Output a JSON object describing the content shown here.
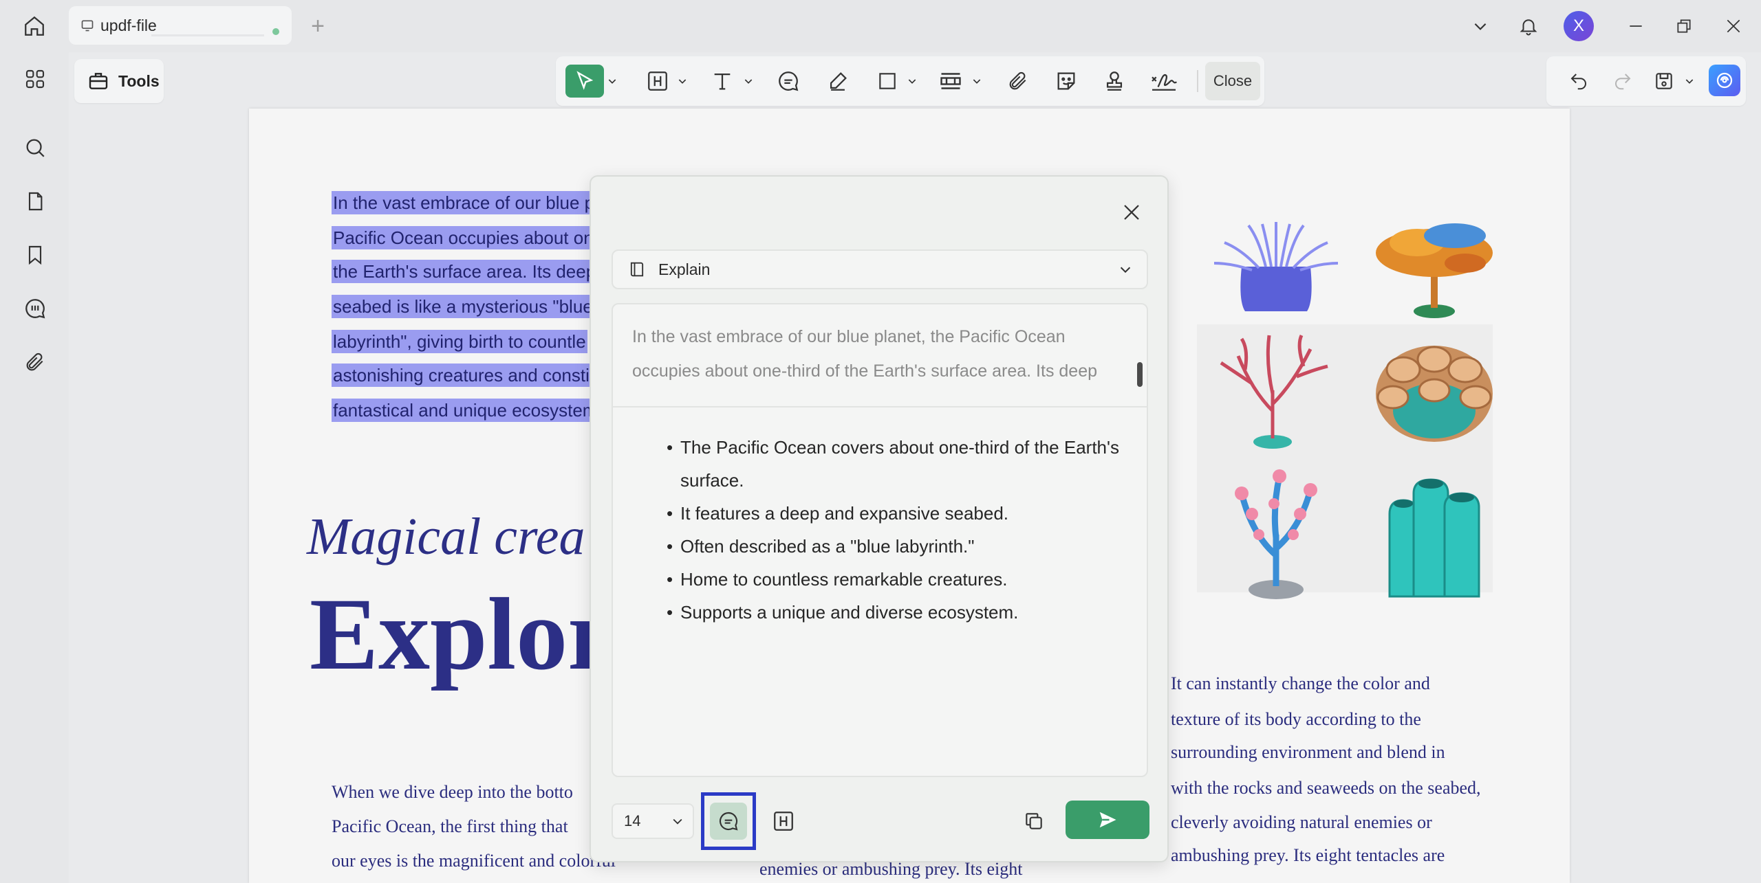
{
  "tab": {
    "title": "updf-file"
  },
  "avatar": {
    "letter": "X"
  },
  "toolbar": {
    "tools_label": "Tools",
    "close_label": "Close"
  },
  "document": {
    "selected_lines": [
      "In the vast embrace of our blue pl",
      "Pacific Ocean occupies about one",
      "the Earth's surface area. Its deep a",
      "seabed is like a mysterious \"blue",
      "labyrinth\", giving birth to countle",
      "astonishing creatures and constitu",
      "fantastical and unique ecosystem."
    ],
    "heading_italic": "Magical crea",
    "heading_big": "Explor",
    "left_para": [
      "When we dive deep into the botto",
      "Pacific Ocean, the first thing that",
      "our eyes is the magnificent and colorful"
    ],
    "middle_line": "enemies or ambushing prey. Its eight",
    "right_para": [
      "It can instantly change the color and",
      "texture of its body according to the",
      "surrounding environment and blend in",
      "with the rocks and seaweeds on the seabed,",
      "cleverly avoiding natural enemies or",
      "ambushing prey. Its eight tentacles are"
    ]
  },
  "dialog": {
    "mode_label": "Explain",
    "source_text": "In the vast embrace of our blue planet, the Pacific Ocean occupies about one-third of the Earth's surface area. Its deep",
    "bullets": [
      "The Pacific Ocean covers about one-third of the Earth's surface.",
      "It features a deep and expansive seabed.",
      "Often described as a \"blue labyrinth.\"",
      "Home to countless remarkable creatures.",
      "Supports a unique and diverse ecosystem."
    ],
    "font_size": "14"
  },
  "colors": {
    "accent_green": "#3a9d6a",
    "selection": "#9a9cf0",
    "highlight_box": "#2b3bc6",
    "doc_text": "#2b2d7e"
  },
  "icons": [
    "home-icon",
    "document-icon",
    "plus-icon",
    "chevron-down-icon",
    "bell-icon",
    "minimize-icon",
    "restore-icon",
    "close-icon",
    "grid-icon",
    "search-icon",
    "pages-icon",
    "bookmark-icon",
    "comments-icon",
    "paperclip-icon",
    "toolbox-icon",
    "cursor-icon",
    "highlight-icon",
    "text-icon",
    "comment-icon",
    "pen-icon",
    "shape-icon",
    "table-icon",
    "attach-icon",
    "sticker-icon",
    "stamp-icon",
    "signature-icon",
    "undo-icon",
    "redo-icon",
    "save-icon",
    "ai-assistant-icon",
    "book-icon",
    "copy-icon",
    "send-icon"
  ]
}
